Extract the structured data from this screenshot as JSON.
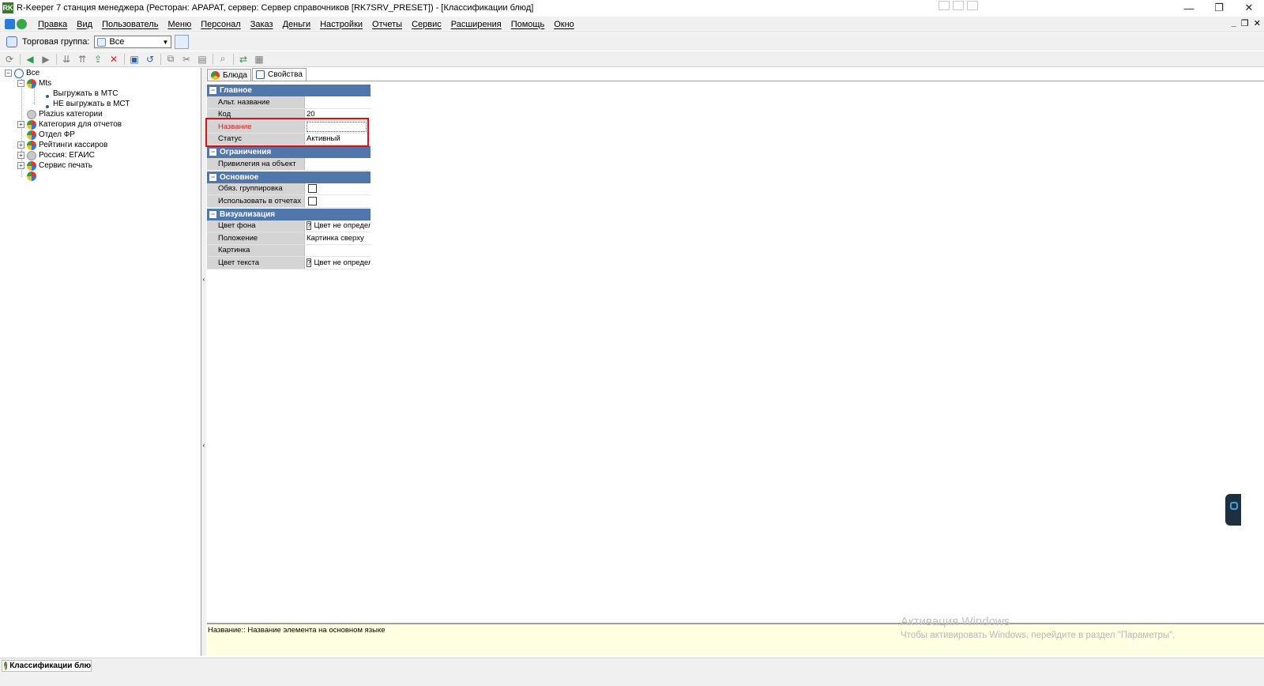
{
  "window": {
    "title": "R-Keeper 7 станция менеджера (Ресторан: АРАРАТ, сервер: Сервер справочников [RK7SRV_PRESET]) - [Классификации блюд]",
    "app_icon_text": "RK",
    "minimize": "—",
    "restore": "❐",
    "close": "✕"
  },
  "menu": {
    "items": [
      "Правка",
      "Вид",
      "Пользователь",
      "Меню",
      "Персонал",
      "Заказ",
      "Деньги",
      "Настройки",
      "Отчеты",
      "Сервис",
      "Расширения",
      "Помощь",
      "Окно"
    ],
    "mdi_min": "_",
    "mdi_restore": "❐",
    "mdi_close": "✕"
  },
  "group_bar": {
    "label": "Торговая группа:",
    "value": "Все"
  },
  "toolbar": {
    "icons": [
      "refresh-icon",
      "back-icon",
      "forward-icon",
      "copy-down-icon",
      "copy-up-icon",
      "export-icon",
      "delete-icon",
      "save-icon",
      "undo-icon",
      "duplicate-icon",
      "cut-icon",
      "paste-icon",
      "search-icon",
      "link-icon",
      "grid-icon"
    ],
    "glyphs": [
      "⟳",
      "◀",
      "▶",
      "⇊",
      "⇈",
      "⇪",
      "✕",
      "▣",
      "↺",
      "⧉",
      "✂",
      "▤",
      "⌕",
      "⇄",
      "▦"
    ]
  },
  "tree": {
    "root": "Все",
    "mts": "Mts",
    "mts_children": [
      "Выгружать в МТС",
      "НЕ выгружать в МСТ"
    ],
    "nodes": [
      "Plazius категории",
      "Категория для отчетов",
      "Отдел ФР",
      "Рейтинги кассиров",
      "Россия: ЕГАИС",
      "Сервис печать"
    ]
  },
  "tabs": {
    "dishes": "Блюда",
    "properties": "Свойства"
  },
  "properties": {
    "main_section": "Главное",
    "alt_name_label": "Альт. название",
    "alt_name_value": "",
    "code_label": "Код",
    "code_value": "20",
    "name_label": "Название",
    "name_value": "",
    "status_label": "Статус",
    "status_value": "Активный",
    "restrictions_section": "Ограничения",
    "privilege_label": "Привилегия на объект",
    "privilege_value": "",
    "basic_section": "Основное",
    "mandatory_group_label": "Обяз. группировка",
    "use_in_reports_label": "Использовать в отчетах",
    "visual_section": "Визуализация",
    "bg_color_label": "Цвет фона",
    "bg_color_value": "Цвет не определ",
    "position_label": "Положение",
    "position_value": "Картинка сверху",
    "picture_label": "Картинка",
    "picture_value": "",
    "text_color_label": "Цвет текста",
    "text_color_value": "Цвет не определ"
  },
  "hint": "Название:: Название элемента на основном языке",
  "activation": {
    "title": "Активация Windows",
    "subtitle": "Чтобы активировать Windows, перейдите в раздел \"Параметры\"."
  },
  "taskbar": {
    "item": "Классификации блю"
  },
  "colors": {
    "category_bg": "#4f77ac",
    "highlight": "#e01010",
    "hint_bg": "#ffffe1",
    "required_label": "#e02020"
  }
}
